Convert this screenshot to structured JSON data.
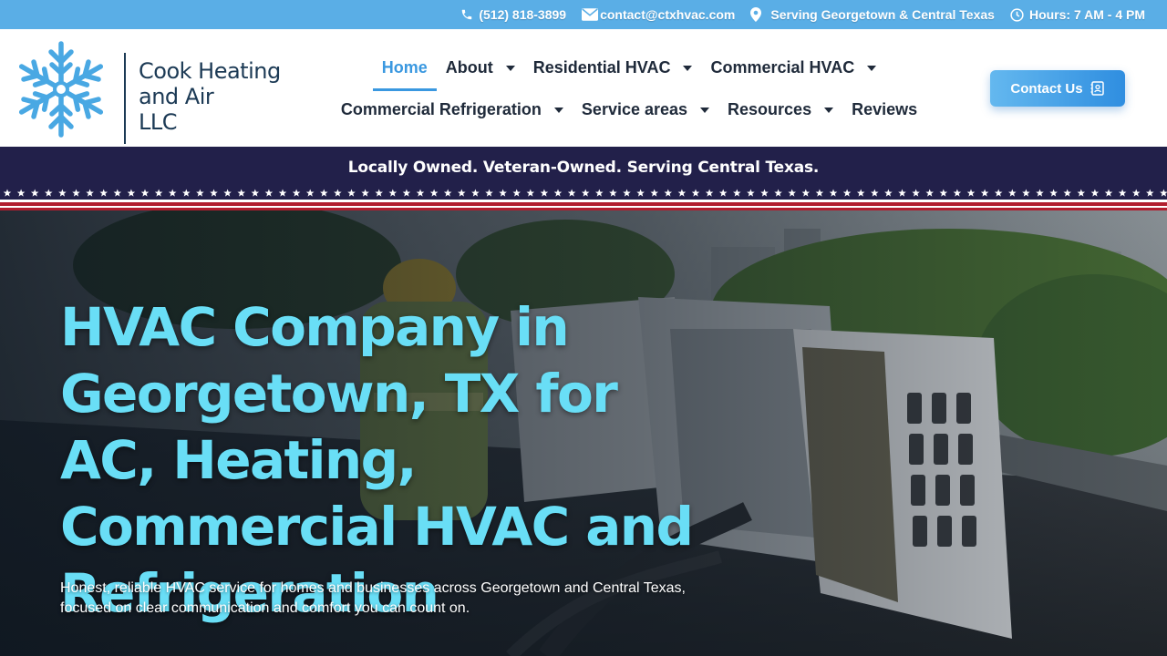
{
  "topbar": {
    "phone": "(512) 818-3899",
    "email": "contact@ctxhvac.com",
    "service_area": "Serving Georgetown & Central Texas",
    "hours": "Hours: 7 AM - 4 PM",
    "icons": [
      "phone-icon",
      "mail-icon",
      "location-pin-icon",
      "clock-icon"
    ]
  },
  "logo": {
    "line1": "Cook Heating",
    "line2": "and Air",
    "line3": "LLC",
    "icon": "snowflake-icon"
  },
  "nav": {
    "row1": [
      {
        "label": "Home",
        "active": true,
        "dropdown": false
      },
      {
        "label": "About",
        "dropdown": true
      },
      {
        "label": "Residential HVAC",
        "dropdown": true
      },
      {
        "label": "Commercial HVAC",
        "dropdown": true
      }
    ],
    "row2": [
      {
        "label": "Commercial Refrigeration",
        "dropdown": true
      },
      {
        "label": "Service areas",
        "dropdown": true
      },
      {
        "label": "Resources",
        "dropdown": true
      },
      {
        "label": "Reviews",
        "dropdown": false
      }
    ]
  },
  "cta": {
    "label": "Contact Us",
    "icon": "contact-card-icon"
  },
  "banner": {
    "text": "Locally Owned. Veteran-Owned. Serving Central Texas."
  },
  "hero": {
    "title": "HVAC Company in Georgetown, TX for AC, Heating, Commercial HVAC and Refrigeration",
    "subtitle": "Honest, reliable HVAC service for homes and businesses across Georgetown and Central Texas, focused on clear communication and comfort you can count on."
  },
  "colors": {
    "topbar": "#5aaee6",
    "accent": "#3a98e0",
    "banner": "#22204a",
    "stripe_red": "#b21e2f",
    "hero_title": "#69def6"
  }
}
